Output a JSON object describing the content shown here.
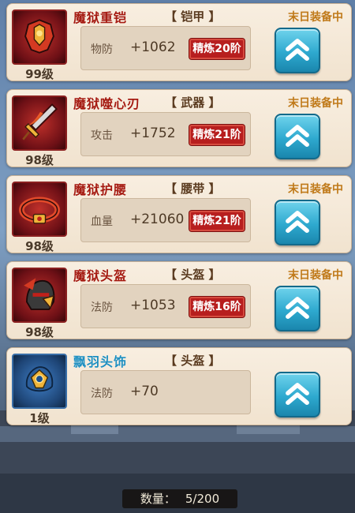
{
  "equipment": [
    {
      "name": "魔狱重铠",
      "slot": "【 铠甲 】",
      "equipped": "末日装备中",
      "level": "99级",
      "stat_label": "物防",
      "stat_value": "+1062",
      "refine": "精炼20阶",
      "icon": "armor-icon",
      "frame_color": "#8b2020"
    },
    {
      "name": "魔狱噬心刃",
      "slot": "【 武器 】",
      "equipped": "末日装备中",
      "level": "98级",
      "stat_label": "攻击",
      "stat_value": "+1752",
      "refine": "精炼21阶",
      "icon": "sword-icon",
      "frame_color": "#8b2020"
    },
    {
      "name": "魔狱护腰",
      "slot": "【 腰带 】",
      "equipped": "末日装备中",
      "level": "98级",
      "stat_label": "血量",
      "stat_value": "+21060",
      "refine": "精炼21阶",
      "icon": "belt-icon",
      "frame_color": "#8b2020"
    },
    {
      "name": "魔狱头盔",
      "slot": "【 头盔 】",
      "equipped": "末日装备中",
      "level": "98级",
      "stat_label": "法防",
      "stat_value": "+1053",
      "refine": "精炼16阶",
      "icon": "helmet-icon",
      "frame_color": "#8b2020"
    },
    {
      "name": "飘羽头饰",
      "slot": "【 头盔 】",
      "equipped": "",
      "level": "1级",
      "stat_label": "法防",
      "stat_value": "+70",
      "refine": "",
      "icon": "headpiece-icon",
      "frame_color": "#3a6fa8"
    }
  ],
  "upgrade_icon": "double-chevron-up-icon",
  "footer": {
    "count_label": "数量：",
    "count_value": "5/200"
  },
  "colors": {
    "name_red": "#a51a10",
    "name_blue": "#1e8fc0",
    "equipped_gold": "#c07a1a",
    "refine_red": "#b71e1e",
    "button_cyan": "#2ea9cf"
  }
}
